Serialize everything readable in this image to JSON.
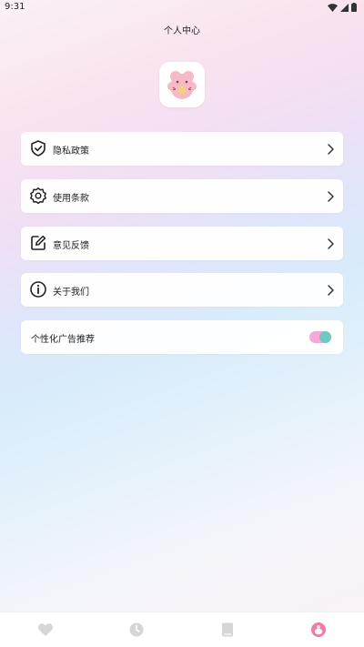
{
  "status_bar": {
    "time": "9:31",
    "icons": [
      "wifi-icon",
      "signal-icon",
      "battery-icon"
    ]
  },
  "header": {
    "title": "个人中心"
  },
  "app_icon": "pink-bear-app-icon",
  "menu": {
    "items": [
      {
        "label": "隐私政策",
        "icon": "shield-check-icon"
      },
      {
        "label": "使用条款",
        "icon": "gear-icon"
      },
      {
        "label": "意见反馈",
        "icon": "edit-icon"
      },
      {
        "label": "关于我们",
        "icon": "info-icon"
      }
    ],
    "toggle": {
      "label": "个性化广告推荐",
      "enabled": true
    }
  },
  "bottom_nav": {
    "items": [
      {
        "icon": "heart-icon",
        "active": false
      },
      {
        "icon": "clock-icon",
        "active": false
      },
      {
        "icon": "book-icon",
        "active": false
      },
      {
        "icon": "profile-icon",
        "active": true
      }
    ]
  },
  "colors": {
    "accent_pink": "#f27aa8",
    "toggle_track": "#f4a9d6",
    "toggle_knob": "#6ec9c2",
    "inactive_nav": "#d9d9d9"
  }
}
